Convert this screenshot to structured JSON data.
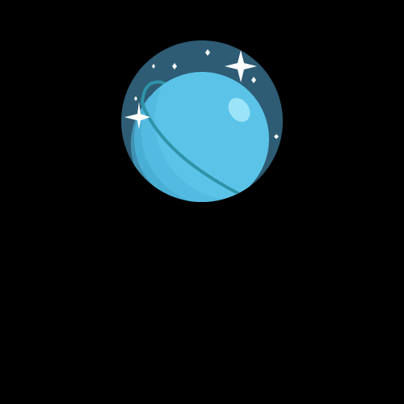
{
  "scene": {
    "subject_icon": "planet-uranus-icon",
    "colors": {
      "background": "#000000",
      "sky": "#2D5C74",
      "planet_light": "#5BC3E8",
      "planet_mid": "#4FB6DC",
      "planet_shade": "#45A6CB",
      "ring": "#2F93A8",
      "highlight": "#9BE3F7",
      "star": "#FFFFFF"
    }
  }
}
